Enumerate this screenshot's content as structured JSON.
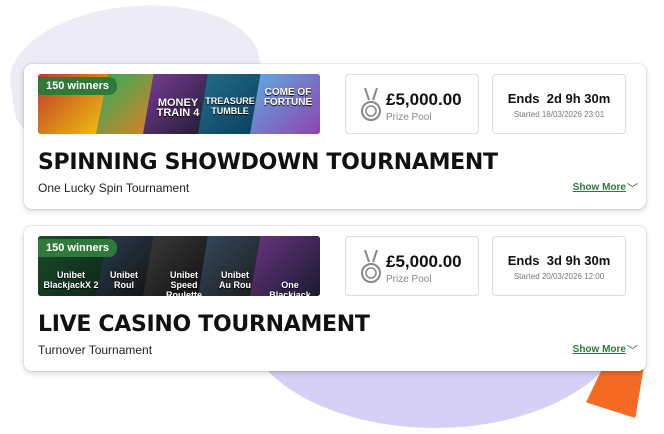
{
  "tournaments": [
    {
      "badge": "150 winners",
      "tiles": [
        "",
        "",
        "MONEY TRAIN 4",
        "TREASURE TUMBLE",
        "COME OF FORTUNE"
      ],
      "prize_amount": "£5,000.00",
      "prize_label": "Prize Pool",
      "ends": "Ends  2d 9h 30m",
      "started": "Started 18/03/2026 23:01",
      "title": "SPINNING SHOWDOWN TOURNAMENT",
      "subtitle": "One Lucky Spin Tournament",
      "show_more": "Show More"
    },
    {
      "badge": "150 winners",
      "tiles": [
        "Unibet BlackjackX 2",
        "Unibet Roul",
        "Unibet Speed Roulette",
        "Unibet Au Rou",
        "One Blackjack"
      ],
      "prize_amount": "£5,000.00",
      "prize_label": "Prize Pool",
      "ends": "Ends  3d 9h 30m",
      "started": "Started 20/03/2026 12:00",
      "title": "LIVE CASINO TOURNAMENT",
      "subtitle": "Turnover Tournament",
      "show_more": "Show More"
    }
  ],
  "colors": {
    "accent_green": "#2d7a3a",
    "accent_orange": "#f46a23",
    "blob_purple": "#d6cff6"
  },
  "icons": {
    "medal": "medal-icon",
    "chevron": "chevron-down-icon"
  }
}
